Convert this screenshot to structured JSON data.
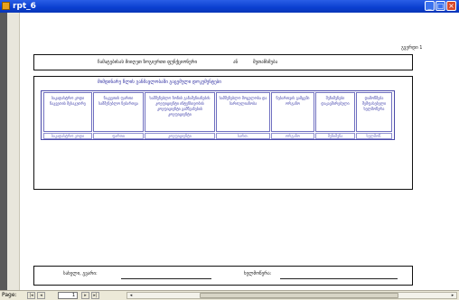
{
  "window": {
    "title": "rpt_6",
    "minimize_glyph": "_",
    "maximize_glyph": "□",
    "close_glyph": "×"
  },
  "report": {
    "page_number_label": "გვერდი 1",
    "header": {
      "left_text": "ჩამატებისას მიიღეთ ზოგიერთი ფუნქციონერი",
      "middle_text": "ან",
      "right_text": "შეთანხმება"
    },
    "table_title": "მიმდინარე წლის განმავლობაში გაცემული დოკუმენტები",
    "columns": [
      "საკადასტრო კოდი ნაკვეთის მესაკუთრე",
      "ნაკვეთის ფართი სამშენებლო ნებართვა",
      "სამშენებლო ზონის განაშენიანების კოეფიციენტი ინტენსივობის კოეფიციენტი გამწვანების კოეფიციენტი",
      "სამშენებლო მოცულობა და სართულიანობა",
      "ნებართვის გამცემი ორგანო",
      "შენიშვნები დაკავშირებული",
      "დამოწმება შემფასებელი ხელმოწერა"
    ],
    "data_row": [
      "საკადასტრო კოდი",
      "ფართი",
      "კოეფიციენტი",
      "სართ.",
      "ორგანო",
      "შენიშვნა",
      "ხელმოწ."
    ],
    "footer": {
      "left_label": "სახელი, გვარი:",
      "right_label": "ხელმოწერა:"
    }
  },
  "statusbar": {
    "page_label": "Page:",
    "first_glyph": "|◂",
    "prev_glyph": "◂",
    "current_page": "1",
    "next_glyph": "▸",
    "last_glyph": "▸|",
    "scroll_left": "◂",
    "scroll_right": "▸"
  }
}
